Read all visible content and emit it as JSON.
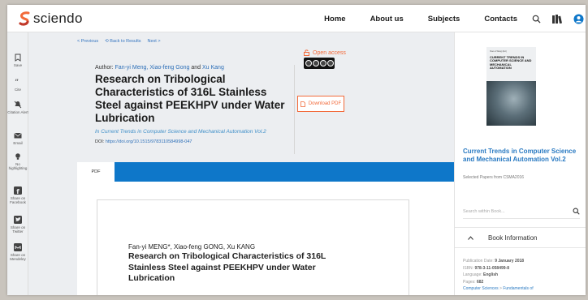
{
  "brand": {
    "name": "sciendo",
    "accent": "#f26a3a",
    "blue": "#0e77c9"
  },
  "nav": {
    "home": "Home",
    "about": "About us",
    "subjects": "Subjects",
    "contacts": "Contacts"
  },
  "sidebar": {
    "items": [
      {
        "label": "Save",
        "icon": "bookmark-icon"
      },
      {
        "label": "Cite",
        "icon": "quote-icon"
      },
      {
        "label": "Citation Alert",
        "icon": "bell-off-icon"
      },
      {
        "label": "Email",
        "icon": "mail-icon"
      },
      {
        "label": "No highlighting",
        "icon": "bulb-icon"
      },
      {
        "label": "Share on Facebook",
        "icon": "facebook-icon"
      },
      {
        "label": "Share on Twitter",
        "icon": "twitter-icon"
      },
      {
        "label": "Share on Mendeley",
        "icon": "mendeley-icon"
      }
    ]
  },
  "breadcrumbs": {
    "previous": "< Previous",
    "back": "Back to Results",
    "next": "Next >"
  },
  "article": {
    "author_prefix": "Author:",
    "author_1": "Fan-yi Meng,",
    "author_2": "Xiao-feng Gong",
    "author_and": "and",
    "author_3": "Xu Kang",
    "title": "Research on Tribological Characteristics of 316L Stainless Steel against PEEKHPV under Water Lubrication",
    "book": "In Current Trends in Computer Science and Mechanical Automation Vol.2",
    "doi_label": "DOI:",
    "doi": "https://doi.org/10.1515/9783110584998-047",
    "open_access": "Open access",
    "download_label": "Download PDF"
  },
  "pdf": {
    "tab": "PDF",
    "authors": "Fan-yi MENG*, Xiao-feng GONG, Xu KANG",
    "title": "Research on Tribological Characteristics of 316L Stainless Steel against PEEKHPV under Water Lubrication"
  },
  "right": {
    "cover_title": "CURRENT TRENDS IN COMPUTER SCIENCE AND MECHANICAL AUTOMATION",
    "cover_small": "Xiao-Li Wang (Ed.)",
    "book_title": "Current Trends in Computer Science and Mechanical Automation Vol.2",
    "subtitle": "Selected Papers from CSMA2016",
    "search_placeholder": "Search within Book...",
    "book_info": "Book Information",
    "meta": {
      "pub_label": "Publication Date:",
      "pub": "9 January 2018",
      "isbn_label": "ISBN:",
      "isbn": "978-3-11-058499-8",
      "lang_label": "Language:",
      "lang": "English",
      "pages_label": "Pages:",
      "pages": "682",
      "subject_1": "Computer Sciences",
      "subject_sep": ">",
      "subject_2": "Fundamentals of"
    }
  }
}
